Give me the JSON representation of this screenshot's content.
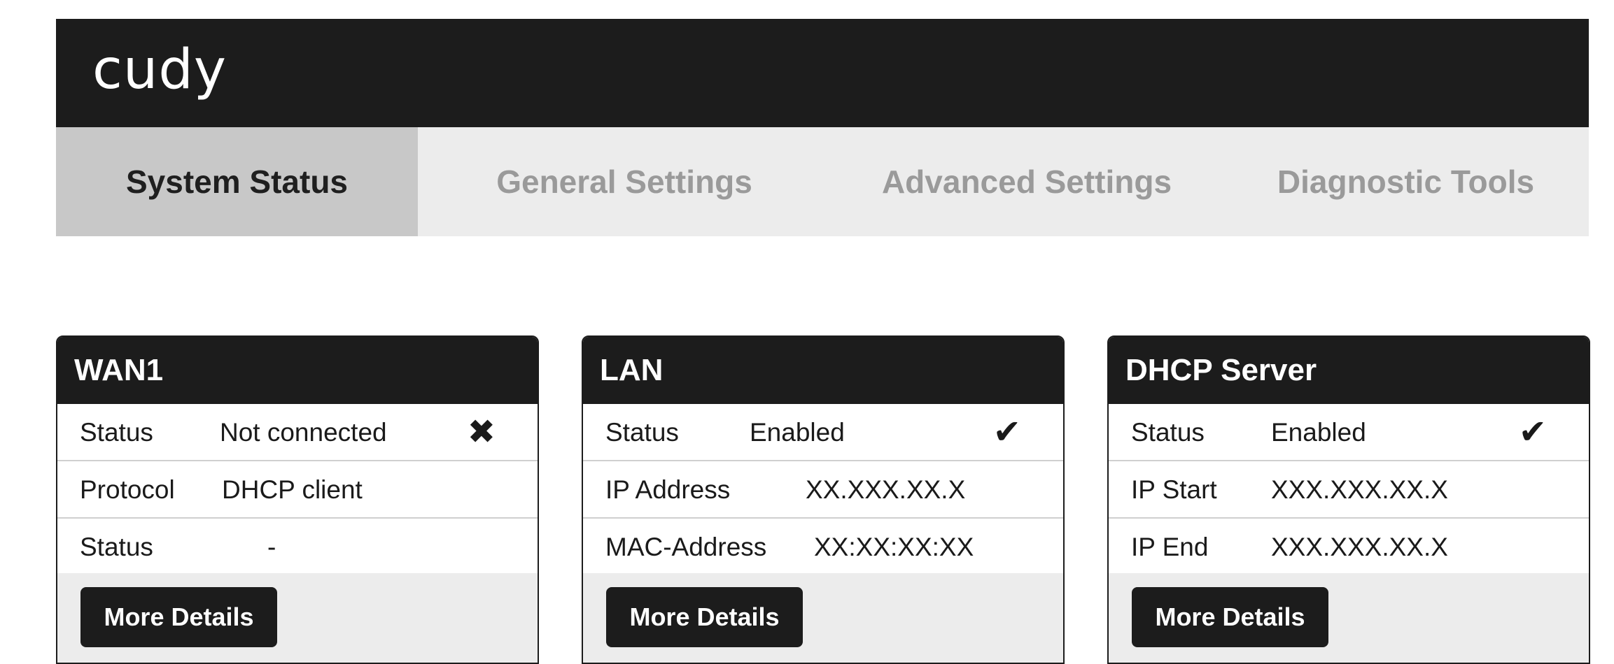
{
  "header": {
    "logo_text": "cudy"
  },
  "nav": {
    "tabs": [
      {
        "label": "System Status",
        "active": true
      },
      {
        "label": "General Settings",
        "active": false
      },
      {
        "label": "Advanced Settings",
        "active": false
      },
      {
        "label": "Diagnostic Tools",
        "active": false
      }
    ]
  },
  "cards": {
    "wan1": {
      "title": "WAN1",
      "rows": [
        {
          "label": "Status",
          "value": "Not connected",
          "icon": "close-icon"
        },
        {
          "label": "Protocol",
          "value": "DHCP client"
        },
        {
          "label": "Status",
          "value": "-"
        }
      ],
      "button": "More Details"
    },
    "lan": {
      "title": "LAN",
      "rows": [
        {
          "label": "Status",
          "value": "Enabled",
          "icon": "check-icon"
        },
        {
          "label": "IP Address",
          "value": "XX.XXX.XX.X"
        },
        {
          "label": "MAC-Address",
          "value": "XX:XX:XX:XX"
        }
      ],
      "button": "More Details"
    },
    "dhcp": {
      "title": "DHCP Server",
      "rows": [
        {
          "label": "Status",
          "value": "Enabled",
          "icon": "check-icon"
        },
        {
          "label": "IP Start",
          "value": "XXX.XXX.XX.X"
        },
        {
          "label": "IP End",
          "value": "XXX.XXX.XX.X"
        }
      ],
      "button": "More Details"
    }
  },
  "icons": {
    "close": "✖",
    "check": "✔"
  },
  "colors": {
    "header_bg": "#1c1c1c",
    "nav_bg": "#ececec",
    "active_tab_bg": "#c8c8c8",
    "inactive_tab_text": "#9a9a9a"
  }
}
